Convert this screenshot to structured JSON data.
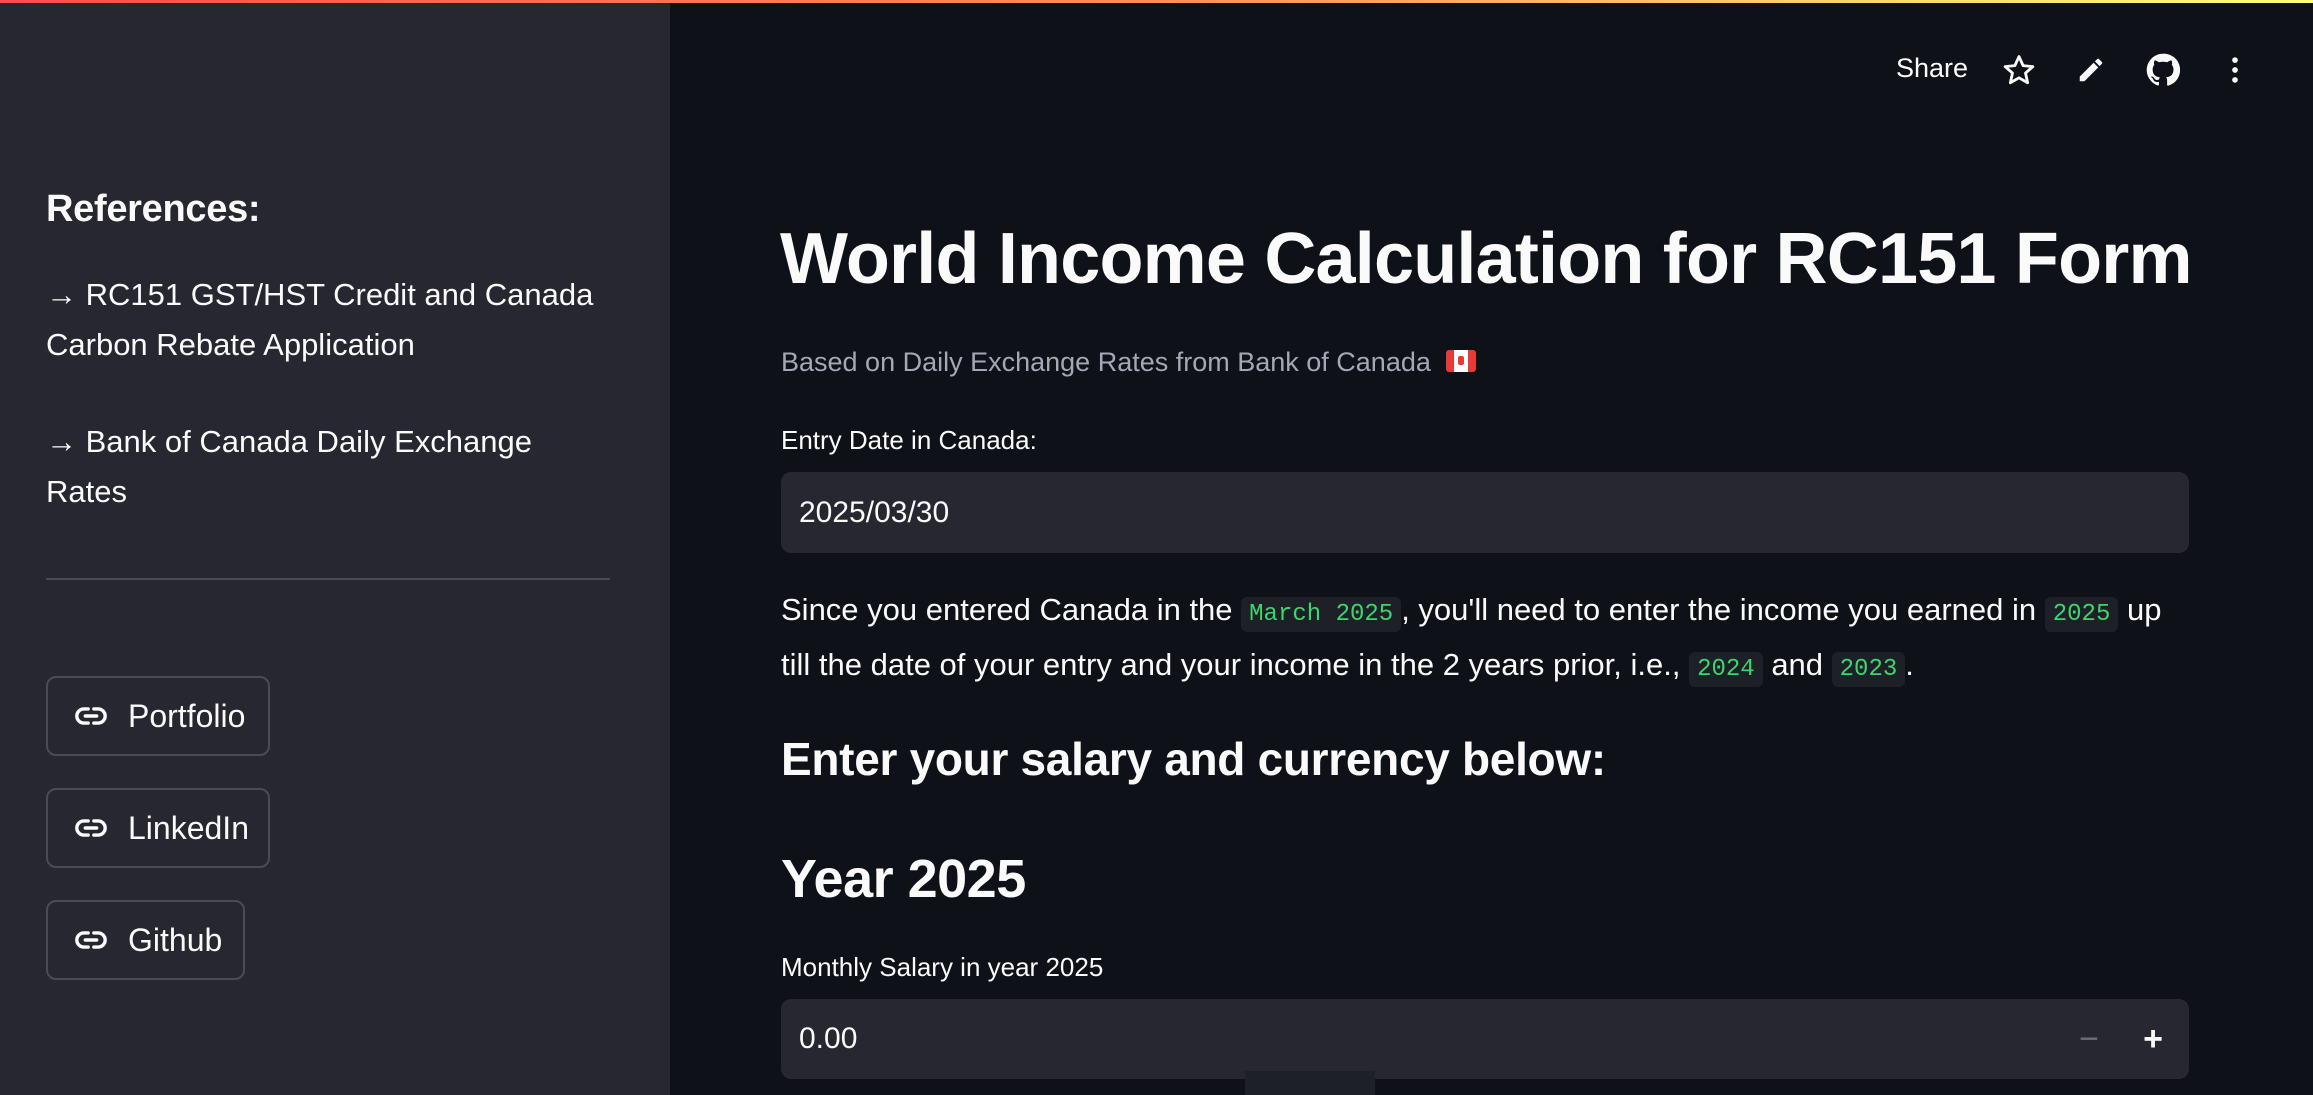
{
  "sidebar": {
    "references_title": "References:",
    "links": [
      "→ RC151 GST/HST Credit and Canada Carbon Rebate Application",
      "→ Bank of Canada Daily Exchange Rates"
    ],
    "buttons": [
      {
        "label": "Portfolio",
        "icon": "link-icon"
      },
      {
        "label": "LinkedIn",
        "icon": "link-icon"
      },
      {
        "label": "Github",
        "icon": "link-icon"
      }
    ]
  },
  "toolbar": {
    "share_label": "Share",
    "icons": [
      "star-icon",
      "pencil-icon",
      "github-icon",
      "more-vertical-icon"
    ]
  },
  "main": {
    "title": "World Income Calculation for RC151 Form",
    "subtitle": "Based on Daily Exchange Rates from Bank of Canada",
    "subtitle_flag": "canada-flag-icon",
    "entry_date_label": "Entry Date in Canada:",
    "entry_date_value": "2025/03/30",
    "paragraph": {
      "p1": "Since you entered Canada in the ",
      "code_month": "March 2025",
      "p2": ", you'll need to enter the income you earned in ",
      "code_year": "2025",
      "p3": " up till the date of your entry and your income in the 2 years prior, i.e., ",
      "code_prev1": "2024",
      "p4": " and ",
      "code_prev2": "2023",
      "p5": "."
    },
    "section_heading": "Enter your salary and currency below:",
    "year_heading": "Year 2025",
    "salary_label": "Monthly Salary in year 2025",
    "salary_value": "0.00",
    "minus_label": "−",
    "plus_label": "+"
  },
  "colors": {
    "sidebar_bg": "#262730",
    "main_bg": "#0e1117",
    "code_green": "#3dd56d",
    "subtitle_gray": "#a3a8b4"
  }
}
